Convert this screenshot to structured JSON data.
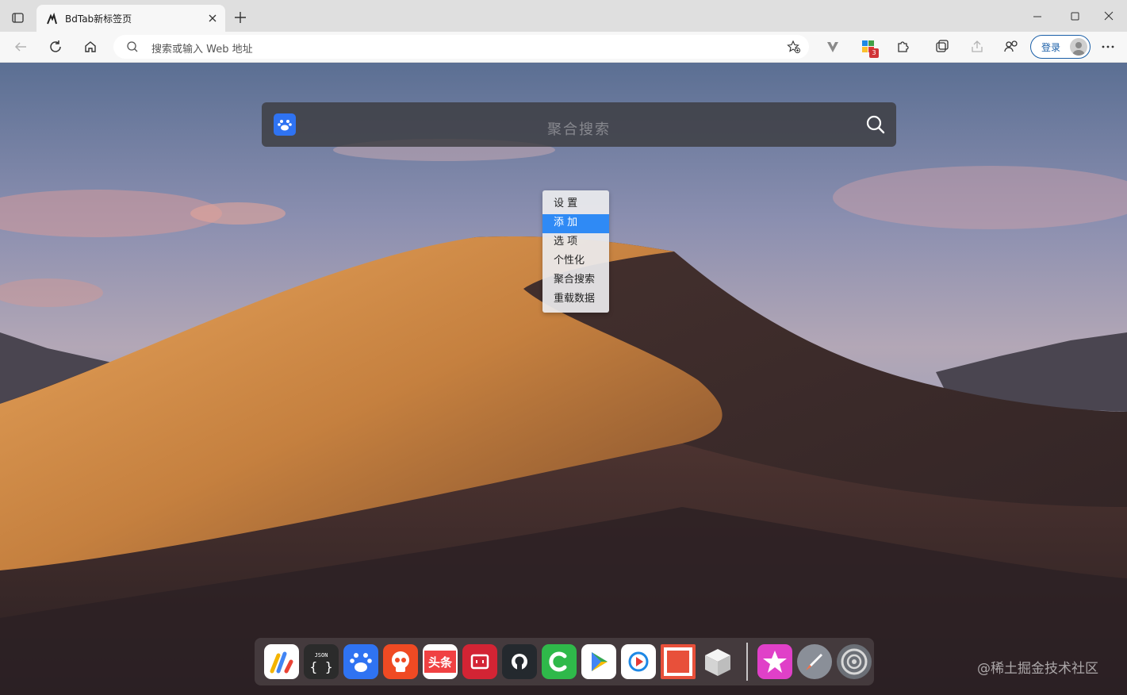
{
  "tab": {
    "title": "BdTab新标签页"
  },
  "toolbar": {
    "address_placeholder": "搜索或输入 Web 地址",
    "signin_label": "登录",
    "extension_badge": "3"
  },
  "search": {
    "placeholder": "聚合搜索"
  },
  "context_menu": {
    "items": [
      {
        "label": "设 置"
      },
      {
        "label": "添 加",
        "active": true
      },
      {
        "label": "选 项"
      },
      {
        "label": "个性化"
      },
      {
        "label": "聚合搜索"
      },
      {
        "label": "重载数据"
      }
    ]
  },
  "dock": {
    "items": [
      {
        "name": "bdtab-icon",
        "color": "#ffffff"
      },
      {
        "name": "json-icon",
        "color": "#2b2b2b"
      },
      {
        "name": "baidu-icon",
        "color": "#2f73f2"
      },
      {
        "name": "skull-icon",
        "color": "#ef4a23"
      },
      {
        "name": "toutiao-icon",
        "color": "#f04142",
        "text": "头条"
      },
      {
        "name": "bilibili-icon",
        "color": "#d32434"
      },
      {
        "name": "github-icon",
        "color": "#24292e"
      },
      {
        "name": "c-icon",
        "color": "#2fb94a"
      },
      {
        "name": "play-icon",
        "color": "#ffffff"
      },
      {
        "name": "video-icon",
        "color": "#ffffff"
      },
      {
        "name": "red-square-icon",
        "color": "#e8503a"
      },
      {
        "name": "cube-icon",
        "color": "#e8e8e8"
      },
      {
        "name": "star-icon",
        "color": "#e040c8"
      },
      {
        "name": "rocket-icon",
        "color": "#8a8f98"
      },
      {
        "name": "settings-icon",
        "color": "#6b6f76"
      }
    ]
  },
  "watermark": "@稀土掘金技术社区"
}
